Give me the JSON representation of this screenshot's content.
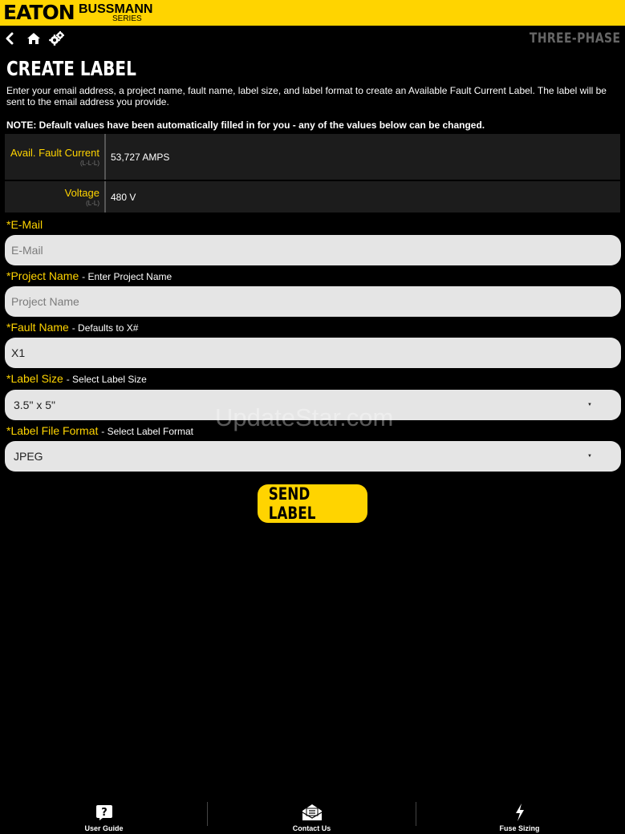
{
  "brand": {
    "name": "EATON",
    "sub": "BUSSMANN",
    "series": "SERIES"
  },
  "nav": {
    "phase": "THREE-PHASE"
  },
  "page": {
    "title": "CREATE LABEL",
    "intro": "Enter your email address, a project name, fault name, label size, and label format to create an Available Fault Current Label. The label will be sent to the email address you provide.",
    "note": "NOTE: Default values have been automatically filled in for you - any of the values below can be changed."
  },
  "info": {
    "fault_label": "Avail. Fault Current",
    "fault_sub": "(L-L-L)",
    "fault_value": "53,727 AMPS",
    "voltage_label": "Voltage",
    "voltage_sub": "(L-L)",
    "voltage_value": "480 V"
  },
  "form": {
    "email_label": "*E-Mail",
    "email_placeholder": "E-Mail",
    "project_label": "*Project Name",
    "project_hint": "- Enter Project Name",
    "project_placeholder": "Project Name",
    "fault_label": "*Fault Name",
    "fault_hint": "- Defaults to X#",
    "fault_value": "X1",
    "size_label": "*Label Size",
    "size_hint": "- Select Label Size",
    "size_value": "3.5\" x 5\"",
    "format_label": "*Label File Format",
    "format_hint": "- Select Label Format",
    "format_value": "JPEG",
    "send": "SEND LABEL"
  },
  "watermark": "UpdateStar.com",
  "tabs": [
    {
      "label": "User Guide",
      "icon": "question-icon"
    },
    {
      "label": "Contact Us",
      "icon": "mail-icon"
    },
    {
      "label": "Fuse Sizing",
      "icon": "lightning-icon"
    }
  ],
  "colors": {
    "brand_yellow": "#ffd400",
    "background": "#000000",
    "field_bg": "#e5e5e5"
  }
}
